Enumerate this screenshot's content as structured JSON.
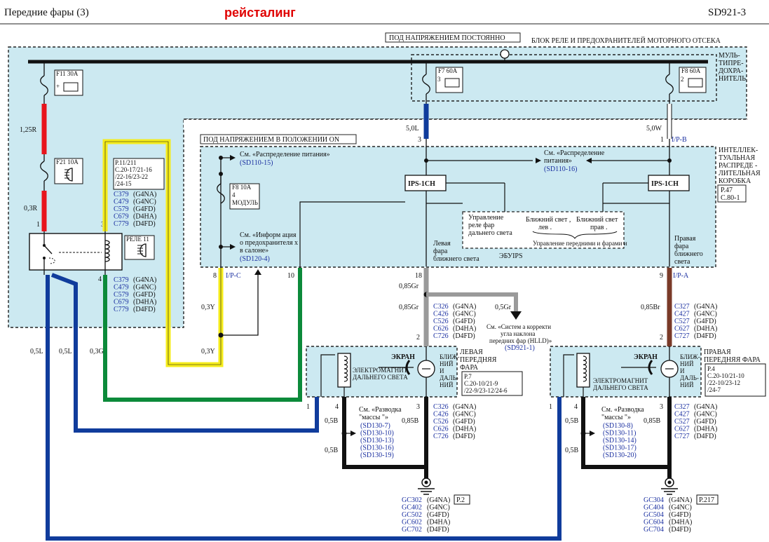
{
  "header": {
    "title": "Передние   фары  (3)",
    "badge": "рейсталинг",
    "code": "SD921-3"
  },
  "colors": {
    "panel": "#cce9f1",
    "red": "#e8141c",
    "yellow": "#f5ec1b",
    "green": "#0c8a3a",
    "blue": "#103c9c",
    "gray": "#9a9a9a",
    "brown": "#7a3a28",
    "link": "#1a2fa0"
  },
  "labels": {
    "always_on": "ПОД НАПРЯЖЕНИЕМ ПОСТОЯННО",
    "engine_box": "БЛОК РЕЛЕ И ПРЕДОХРАНИТЕЛЕЙ МОТОРНОГО ОТСЕКА",
    "mfuse": [
      "МУЛЬ-",
      "ТИПРЕ-",
      "ДОХРА-",
      "НИТЕЛЬ"
    ],
    "on_power": "ПОД НАПРЯЖЕНИЕМ  В ПОЛОЖЕНИИ ON",
    "ijb": [
      "ИНТЕЛЛЕК-",
      "ТУАЛЬНАЯ",
      "РАСПРЕДЕ -",
      "ЛИТЕЛЬНАЯ",
      "КОРОБКА"
    ],
    "ijb_ref": [
      "P.47",
      "C.80-1"
    ],
    "f11": "F11 30A",
    "f21": "F21 10A",
    "f7": "F7 60A",
    "f8": "F8 60A",
    "f8b": "F8 10A",
    "module_num": "4",
    "module": "МОДУЛЬ",
    "relay": "РЕЛЕ 11",
    "ref_p11": [
      "P.11/211",
      "C.20-17/21-16",
      "/22-16/23-22",
      "/24-15"
    ],
    "ref_pd1": [
      "См. «Распределение    питания»",
      "(SD110-15)"
    ],
    "ref_pd2": [
      "См. «Распределение",
      "питания»",
      "(SD110-16)"
    ],
    "ref_info": [
      "См. «Информ ация",
      "о предохранителя  х",
      "в салоне»",
      "(SD120-4)"
    ],
    "ips": "IPS-1CH",
    "ctrl_high": [
      "Управление",
      "реле  фар",
      "дальнего   света"
    ],
    "low_l": [
      "Ближний свет ,",
      "лев ."
    ],
    "low_r": [
      "Ближний свет",
      "прав ."
    ],
    "ctrl_front": "Управление   передними  и фарами  и",
    "ecu": "ЭБУIPS",
    "left_low": [
      "Левая",
      "фара",
      "ближнего  света"
    ],
    "right_low": [
      "Правая",
      "фара",
      "ближнего",
      "света"
    ],
    "wire_125r": "1,25R",
    "wire_03r": "0,3R",
    "wire_50l": "5,0L",
    "wire_50w": "5,0W",
    "wire_03y": "0,3Y",
    "wire_05l": "0,5L",
    "wire_03g": "0,3G",
    "wire_085gr": "0,85Gr",
    "wire_05gr": "0,5Gr",
    "wire_085br": "0,85Br",
    "wire_05b": "0,5B",
    "wire_085b": "0,85B",
    "ipc": "I/P-C",
    "ipb": "I/P-B",
    "ipa": "I/P-A",
    "screen": "ЭКРАН",
    "magnet": [
      "ЭЛЕКТРОМАГНИТ",
      "ДАЛЬНЕГО СВЕТА"
    ],
    "lamp": [
      "БЛИЖ-",
      "НИЙ",
      "И",
      "ДАЛЬ-",
      "НИЙ"
    ],
    "lamp_r": [
      "БЛИЖ-",
      "НИЙ",
      "И",
      "ДАЛЬ-",
      "НИЙ"
    ],
    "left_head": [
      "ЛЕВАЯ",
      "ПЕРЕДНЯЯ",
      "ФАРА"
    ],
    "right_head": [
      "ПРАВАЯ",
      "ПЕРЕДНЯЯ  ФАРА"
    ],
    "ref_p7": [
      "P.7",
      "C.20-10/21-9",
      "/22-9/23-12/24-6"
    ],
    "ref_p4": [
      "P.4",
      "C.20-10/21-10",
      "/22-10/23-12",
      "/24-7"
    ],
    "ground_l": [
      "См. «Разводка",
      "\"массы \"»"
    ],
    "ground_l_links": [
      "(SD130-7)",
      "(SD130-10)",
      "(SD130-13)",
      "(SD130-16)",
      "(SD130-19)"
    ],
    "ground_r": [
      "См. «Разводка",
      "\"массы \"»"
    ],
    "ground_r_links": [
      "(SD130-8)",
      "(SD130-11)",
      "(SD130-14)",
      "(SD130-17)",
      "(SD130-20)"
    ],
    "hlld": [
      "См. «Систем а корректи",
      "угла наклона",
      "передних фар (HLLD)»",
      "(SD921-1)"
    ],
    "p2": "P.2",
    "p217": "P.217"
  },
  "pins": {
    "p1": "1",
    "p2": "2",
    "p3": "3",
    "p4": "4",
    "p8": "8",
    "p9": "9",
    "p10": "10",
    "p18": "18"
  },
  "connector_lists": {
    "relay_top": [
      {
        "c": "C379",
        "m": "(G4NA)"
      },
      {
        "c": "C479",
        "m": "(G4NC)"
      },
      {
        "c": "C579",
        "m": "(G4FD)"
      },
      {
        "c": "C679",
        "m": "(D4HA)"
      },
      {
        "c": "C779",
        "m": "(D4FD)"
      }
    ],
    "relay_bot": [
      {
        "c": "C379",
        "m": "(G4NA)"
      },
      {
        "c": "C479",
        "m": "(G4NC)"
      },
      {
        "c": "C579",
        "m": "(G4FD)"
      },
      {
        "c": "C679",
        "m": "(D4HA)"
      },
      {
        "c": "C779",
        "m": "(D4FD)"
      }
    ],
    "left_top": [
      {
        "c": "C326",
        "m": "(G4NA)"
      },
      {
        "c": "C426",
        "m": "(G4NC)"
      },
      {
        "c": "C526",
        "m": "(G4FD)"
      },
      {
        "c": "C626",
        "m": "(D4HA)"
      },
      {
        "c": "C726",
        "m": "(D4FD)"
      }
    ],
    "left_bot": [
      {
        "c": "C326",
        "m": "(G4NA)"
      },
      {
        "c": "C426",
        "m": "(G4NC)"
      },
      {
        "c": "C526",
        "m": "(G4FD)"
      },
      {
        "c": "C626",
        "m": "(D4HA)"
      },
      {
        "c": "C726",
        "m": "(D4FD)"
      }
    ],
    "right_top": [
      {
        "c": "C327",
        "m": "(G4NA)"
      },
      {
        "c": "C427",
        "m": "(G4NC)"
      },
      {
        "c": "C527",
        "m": "(G4FD)"
      },
      {
        "c": "C627",
        "m": "(D4HA)"
      },
      {
        "c": "C727",
        "m": "(D4FD)"
      }
    ],
    "right_bot": [
      {
        "c": "C327",
        "m": "(G4NA)"
      },
      {
        "c": "C427",
        "m": "(G4NC)"
      },
      {
        "c": "C527",
        "m": "(G4FD)"
      },
      {
        "c": "C627",
        "m": "(D4HA)"
      },
      {
        "c": "C727",
        "m": "(D4FD)"
      }
    ],
    "ground_left": [
      {
        "c": "GC302",
        "m": "(G4NA)"
      },
      {
        "c": "GC402",
        "m": "(G4NC)"
      },
      {
        "c": "GC502",
        "m": "(G4FD)"
      },
      {
        "c": "GC602",
        "m": "(D4HA)"
      },
      {
        "c": "GC702",
        "m": "(D4FD)"
      }
    ],
    "ground_right": [
      {
        "c": "GC304",
        "m": "(G4NA)"
      },
      {
        "c": "GC404",
        "m": "(G4NC)"
      },
      {
        "c": "GC504",
        "m": "(G4FD)"
      },
      {
        "c": "GC604",
        "m": "(D4HA)"
      },
      {
        "c": "GC704",
        "m": "(D4FD)"
      }
    ]
  }
}
